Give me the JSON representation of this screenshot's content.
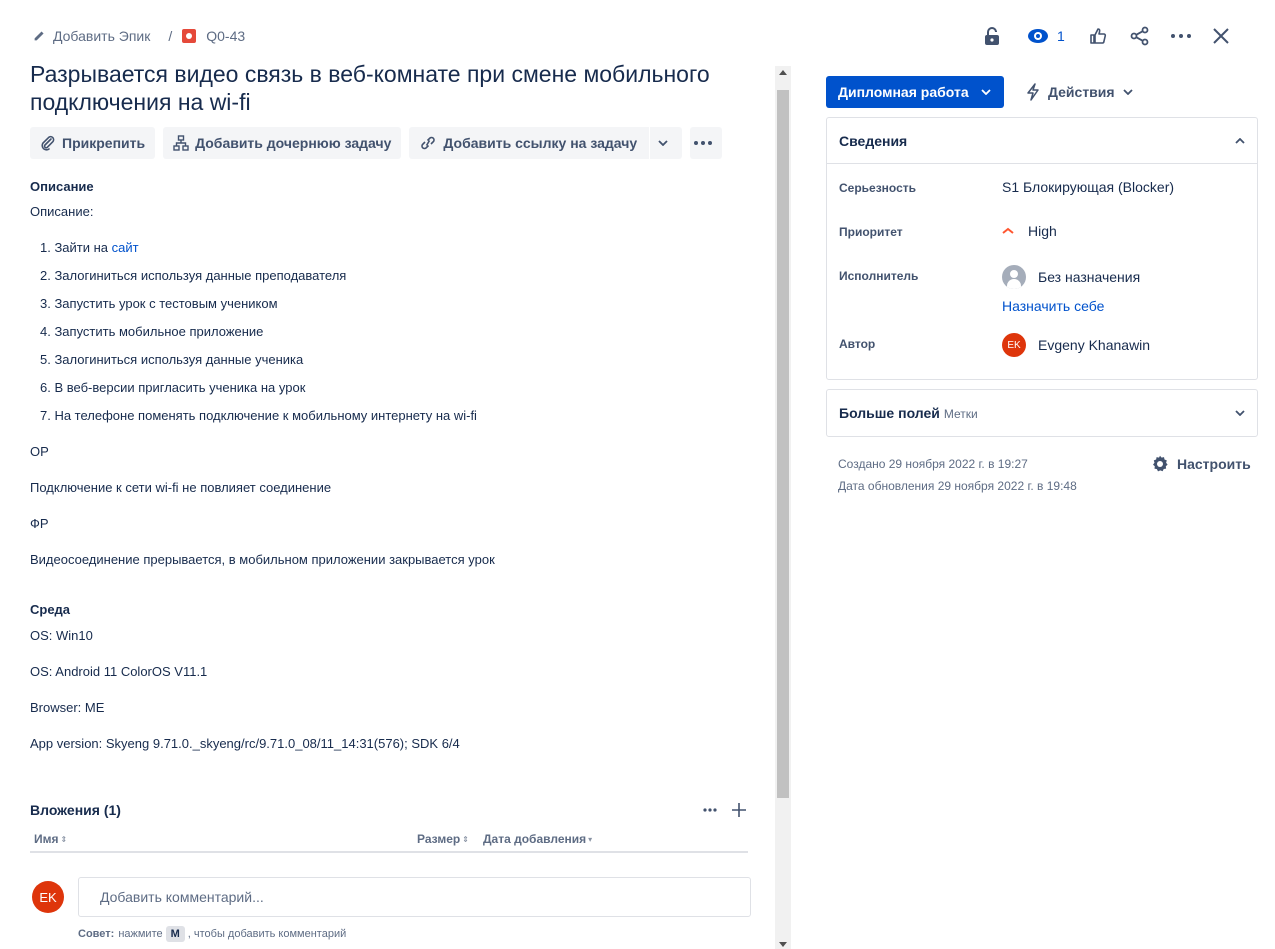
{
  "breadcrumb": {
    "add_epic": "Добавить Эпик",
    "separator": "/",
    "issue_key": "Q0-43"
  },
  "top_actions": {
    "watch_count": "1"
  },
  "issue": {
    "title": "Разрывается видео связь в веб-комнате при смене мобильного подключения на wi-fi"
  },
  "buttons": {
    "attach": "Прикрепить",
    "add_child": "Добавить дочернюю задачу",
    "add_link": "Добавить ссылку на задачу"
  },
  "description": {
    "heading": "Описание",
    "intro": "Описание:",
    "step1_prefix": "1. Зайти на ",
    "step1_link": "сайт",
    "steps": [
      "2. Залогиниться используя данные преподавателя",
      "3. Запустить урок с тестовым учеником",
      "4. Запустить мобильное приложение",
      "5. Залогиниться используя данные ученика",
      "6. В веб-версии пригласить ученика на урок",
      "7. На телефоне поменять подключение к мобильному интернету на wi-fi"
    ],
    "expected_label": "ОР",
    "expected_text": "Подключение к сети wi-fi не повлияет соединение",
    "actual_label": "ФР",
    "actual_text": "Видеосоединение прерывается, в мобильном приложении закрывается урок"
  },
  "environment": {
    "heading": "Среда",
    "lines": [
      "OS: Win10",
      "OS: Android 11 ColorOS V11.1",
      "Browser: ME",
      "App version: Skyeng 9.71.0._skyeng/rc/9.71.0_08/11_14:31(576); SDK 6/4"
    ]
  },
  "attachments": {
    "heading": "Вложения (1)",
    "col_name": "Имя",
    "col_size": "Размер",
    "col_date": "Дата добавления"
  },
  "comment": {
    "avatar_initials": "EK",
    "placeholder": "Добавить комментарий...",
    "tip_bold": "Совет:",
    "tip_before": "нажмите",
    "tip_key": "M",
    "tip_after": ", чтобы добавить комментарий"
  },
  "status": {
    "label": "Дипломная работа",
    "actions": "Действия"
  },
  "details": {
    "heading": "Сведения",
    "severity_label": "Серьезность",
    "severity_value": "S1 Блокирующая (Blocker)",
    "priority_label": "Приоритет",
    "priority_value": "High",
    "assignee_label": "Исполнитель",
    "assignee_value": "Без назначения",
    "assign_to_me": "Назначить себе",
    "reporter_label": "Автор",
    "reporter_initials": "EK",
    "reporter_value": "Evgeny Khanawin"
  },
  "more_fields": {
    "label": "Больше полей",
    "sub": "Метки"
  },
  "meta": {
    "created": "Создано 29 ноября 2022 г. в 19:27",
    "updated": "Дата обновления 29 ноября 2022 г. в 19:48",
    "configure": "Настроить"
  },
  "colors": {
    "primary": "#0052cc",
    "bug_red": "#e5493a",
    "avatar_red": "#de350b",
    "text": "#172b4d",
    "subtle": "#5e6c84"
  }
}
